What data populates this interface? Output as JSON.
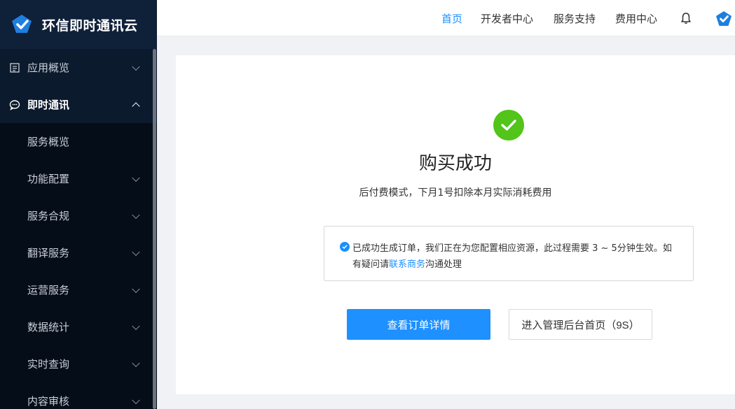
{
  "brand": {
    "name": "环信即时通讯云",
    "accent": "#1890ff"
  },
  "sidebar": {
    "items": [
      {
        "label": "应用概览",
        "icon": "document-icon",
        "expanded": false
      },
      {
        "label": "即时通讯",
        "icon": "chat-icon",
        "expanded": true,
        "children": [
          {
            "label": "服务概览"
          },
          {
            "label": "功能配置"
          },
          {
            "label": "服务合规"
          },
          {
            "label": "翻译服务"
          },
          {
            "label": "运营服务"
          },
          {
            "label": "数据统计"
          },
          {
            "label": "实时查询"
          },
          {
            "label": "内容审核"
          }
        ]
      }
    ]
  },
  "topnav": {
    "items": [
      {
        "label": "首页",
        "active": true
      },
      {
        "label": "开发者中心",
        "active": false
      },
      {
        "label": "服务支持",
        "active": false
      },
      {
        "label": "费用中心",
        "active": false
      }
    ],
    "bell_icon": "bell-icon",
    "avatar_icon": "logo-avatar-icon"
  },
  "result": {
    "status_icon": "check-circle-icon",
    "status_color": "#52c41a",
    "title": "购买成功",
    "subtitle": "后付费模式，下月1号扣除本月实际消耗费用",
    "notice": {
      "text_before": "已成功生成订单，我们正在为您配置相应资源，此过程需要 3 ~ 5分钟生效。如有疑问请",
      "link": "联系商务",
      "text_after": "沟通处理"
    },
    "primary_button": "查看订单详情",
    "secondary_button": "进入管理后台首页（9S）"
  }
}
